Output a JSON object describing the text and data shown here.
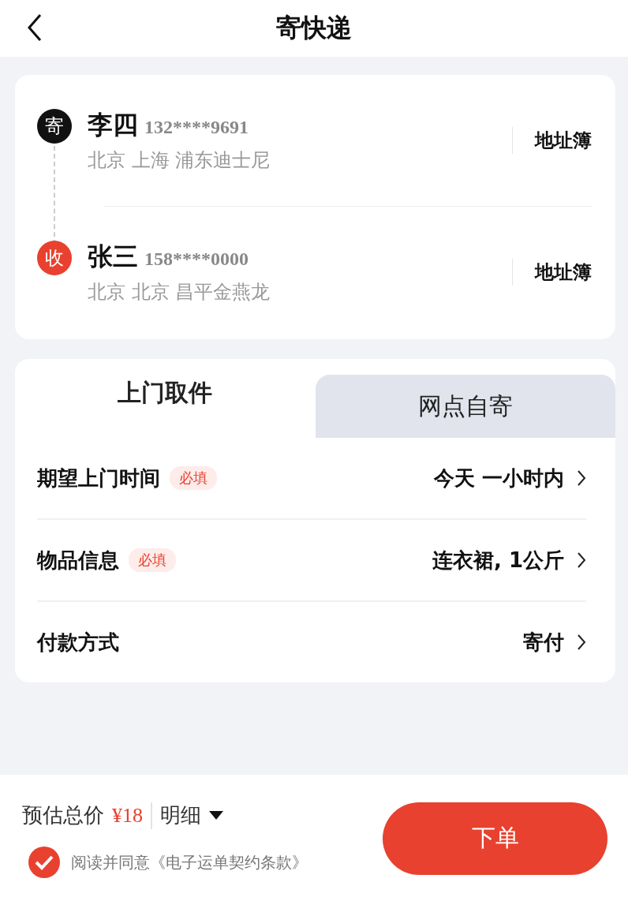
{
  "header": {
    "title": "寄快递"
  },
  "contacts": [
    {
      "kind": "sender",
      "badge": "寄",
      "name": "李四",
      "phone": "132****9691",
      "address": "北京 上海 浦东迪士尼",
      "action": "地址簿"
    },
    {
      "kind": "receiver",
      "badge": "收",
      "name": "张三",
      "phone": "158****0000",
      "address": "北京 北京 昌平金燕龙",
      "action": "地址簿"
    }
  ],
  "tabs": [
    {
      "label": "上门取件",
      "selected": true
    },
    {
      "label": "网点自寄",
      "selected": false
    }
  ],
  "rows": [
    {
      "label": "期望上门时间",
      "tag": "必填",
      "value": "今天 一小时内"
    },
    {
      "label": "物品信息",
      "tag": "必填",
      "value": "连衣裙, 1公斤"
    },
    {
      "label": "付款方式",
      "value": "寄付"
    }
  ],
  "footer": {
    "price_label": "预估总价",
    "price": "¥18",
    "detail": "明细",
    "agree": {
      "checked": true,
      "text": "阅读并同意《电子运单契约条款》"
    },
    "submit": "下单"
  }
}
